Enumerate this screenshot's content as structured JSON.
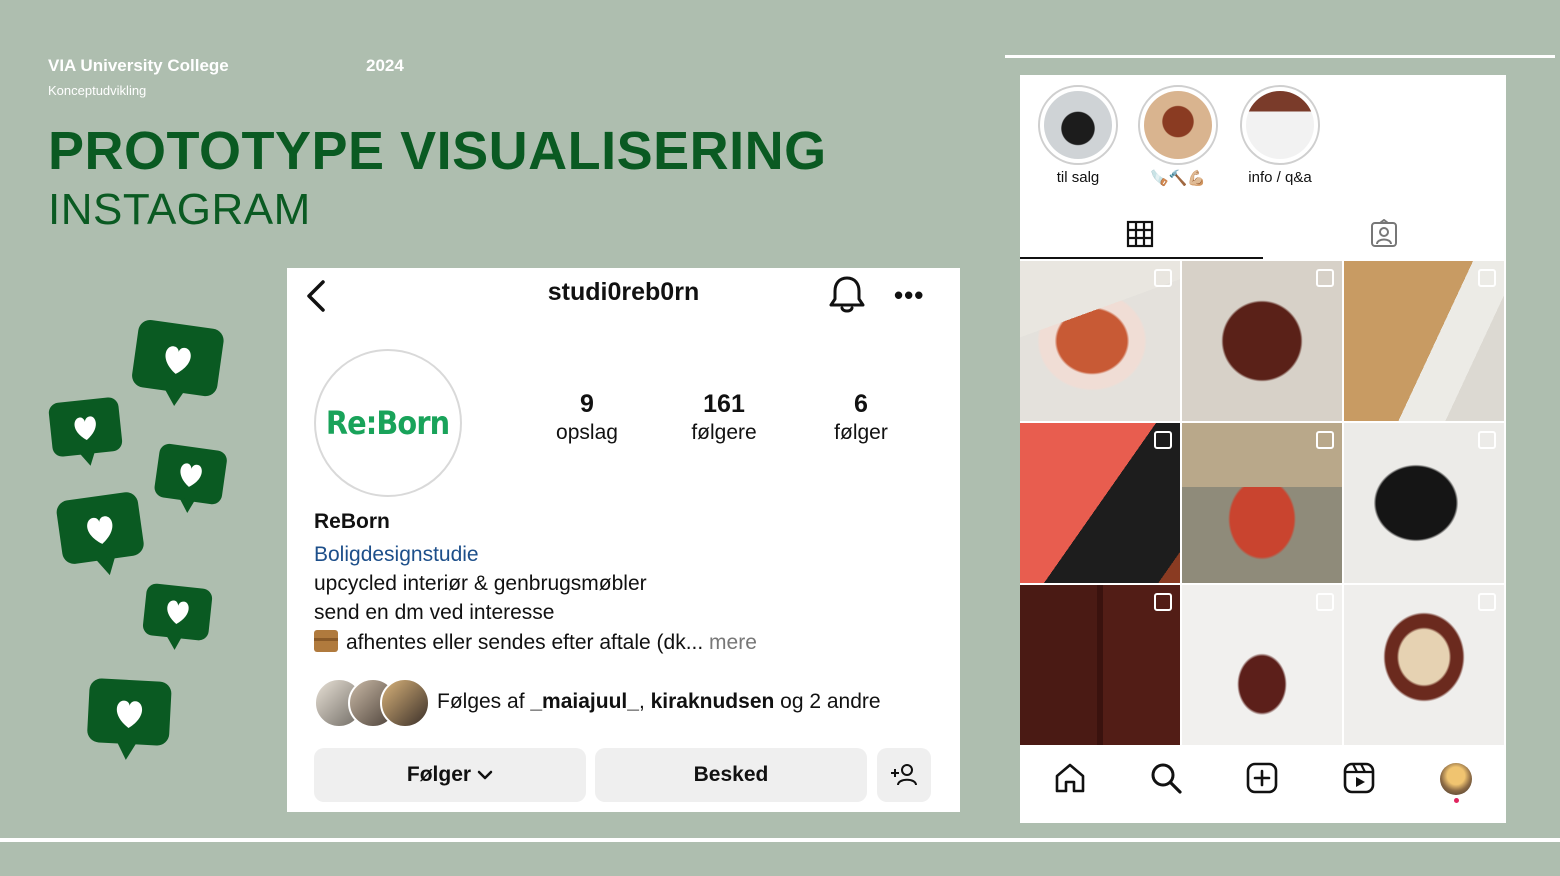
{
  "slide": {
    "org": "VIA University College",
    "year": "2024",
    "department": "Konceptudvikling",
    "title": "PROTOTYPE VISUALISERING",
    "subtitle": "INSTAGRAM"
  },
  "profile": {
    "username": "studi0reb0rn",
    "logo_text": "Re:Born",
    "stats": [
      {
        "num": "9",
        "label": "opslag"
      },
      {
        "num": "161",
        "label": "følgere"
      },
      {
        "num": "6",
        "label": "følger"
      }
    ],
    "name": "ReBorn",
    "category": "Boligdesignstudie",
    "bio_1": "upcycled interiør & genbrugsmøbler",
    "bio_2": "send en dm ved interesse",
    "bio_3": "afhentes eller sendes efter aftale (dk...",
    "bio_more": " mere",
    "followed_prefix": "Følges af ",
    "followed_user1": "_maiajuul_",
    "followed_sep": ", ",
    "followed_user2": "kiraknudsen",
    "followed_suffix": " og 2 andre",
    "follow_btn": "Følger",
    "message_btn": "Besked"
  },
  "highlights": [
    {
      "label": "til salg"
    },
    {
      "label": "🪚🔨💪🏼"
    },
    {
      "label": "info / q&a"
    }
  ],
  "colors": {
    "background": "#aebeaf",
    "accent_green": "#0a5a22",
    "heart_green": "#0a5a22",
    "logo_green": "#19a35a",
    "link_blue": "#1d4f8a"
  }
}
